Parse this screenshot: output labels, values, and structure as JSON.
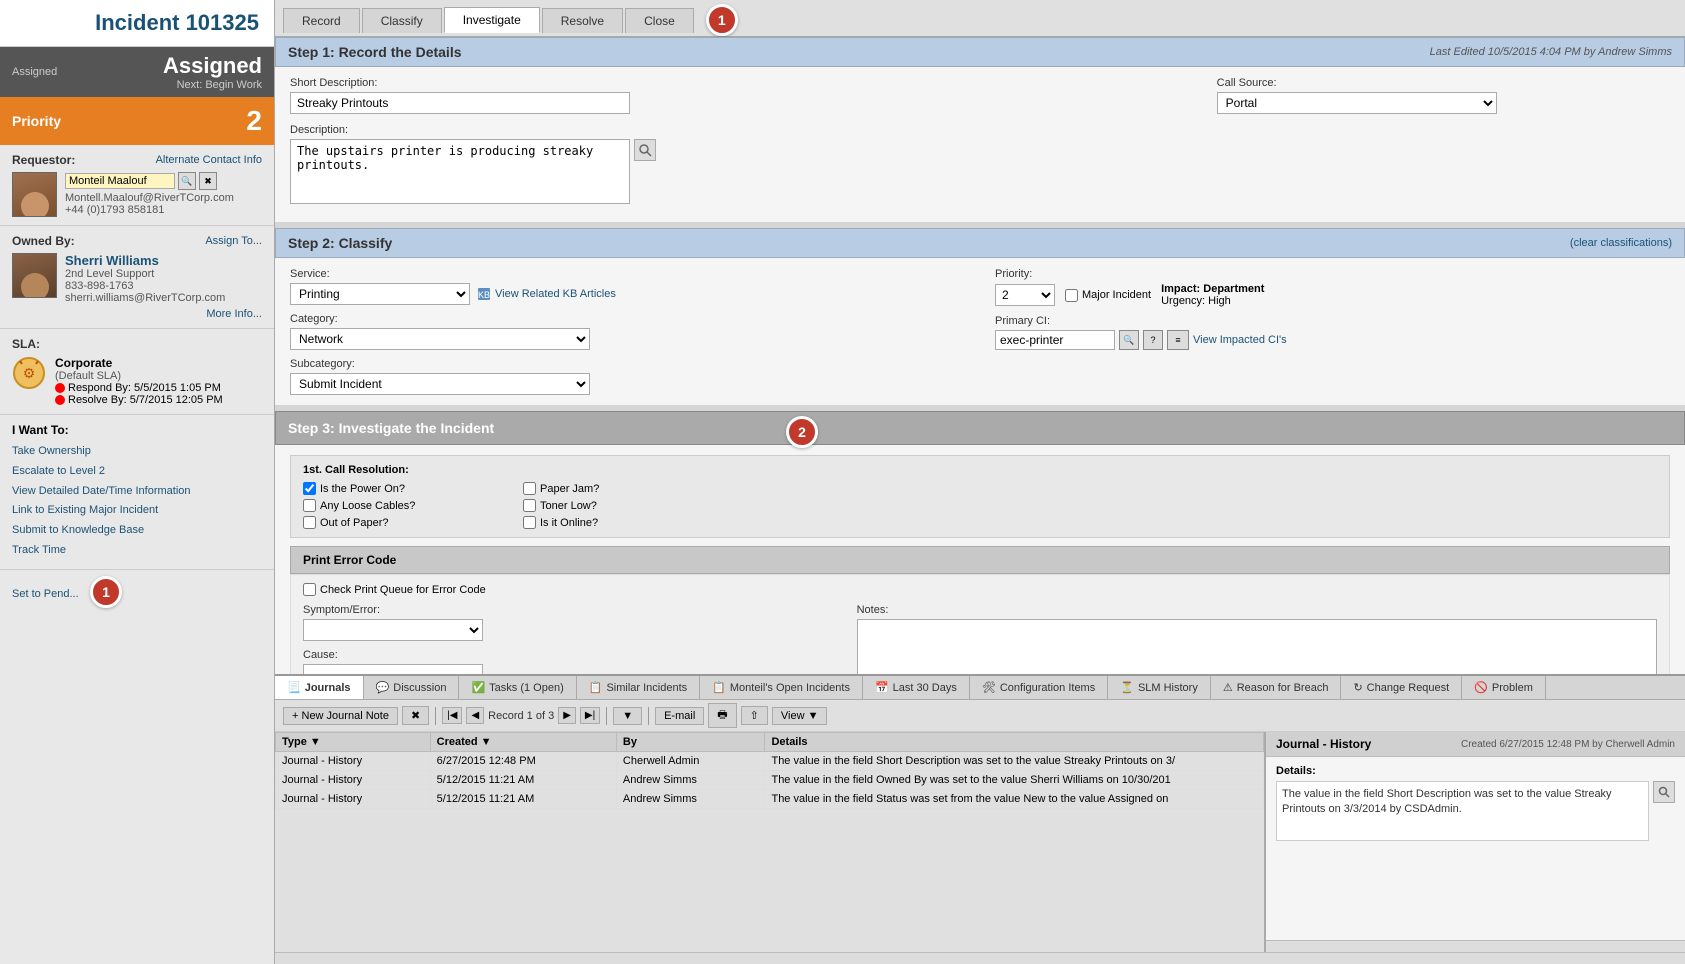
{
  "incident": {
    "title": "Incident 101325",
    "status": "Assigned",
    "status_next": "Next: Begin Work",
    "priority_label": "Priority",
    "priority_num": "2"
  },
  "tabs": {
    "items": [
      "Record",
      "Classify",
      "Investigate",
      "Resolve",
      "Close"
    ],
    "active": "Investigate",
    "badge": "1"
  },
  "requestor": {
    "label": "Requestor:",
    "alt_contact": "Alternate Contact Info",
    "name": "Monteil Maalouf",
    "email": "Montell.Maalouf@RiverTCorp.com",
    "phone": "+44 (0)1793 858181"
  },
  "owned_by": {
    "label": "Owned By:",
    "assign_link": "Assign To...",
    "name": "Sherri Williams",
    "level": "2nd Level Support",
    "phone": "833-898-1763",
    "email": "sherri.williams@RiverTCorp.com",
    "more_info": "More Info..."
  },
  "sla": {
    "label": "SLA:",
    "name": "Corporate",
    "default": "(Default SLA)",
    "respond_by": "Respond By: 5/5/2015 1:05 PM",
    "resolve_by": "Resolve By: 5/7/2015 12:05 PM"
  },
  "i_want_to": {
    "label": "I Want To:",
    "items": [
      "Take Ownership",
      "Escalate to Level 2",
      "View Detailed Date/Time Information",
      "Link to Existing Major Incident",
      "Submit to Knowledge Base",
      "Track Time"
    ]
  },
  "set_to_pending": "Set to Pend...",
  "step1": {
    "title": "Step 1:  Record the Details",
    "last_edited": "Last Edited 10/5/2015 4:04 PM by Andrew Simms",
    "short_desc_label": "Short Description:",
    "short_desc_value": "Streaky Printouts",
    "call_source_label": "Call Source:",
    "call_source_value": "Portal",
    "description_label": "Description:",
    "description_value": "The upstairs printer is producing streaky printouts."
  },
  "step2": {
    "title": "Step 2:  Classify",
    "clear_link": "(clear classifications)",
    "service_label": "Service:",
    "service_value": "Printing",
    "view_kb": "View Related KB Articles",
    "priority_label": "Priority:",
    "priority_value": "2",
    "major_incident_label": "Major Incident",
    "impact_label": "Impact: Department",
    "urgency_label": "Urgency: High",
    "category_label": "Category:",
    "category_value": "Network",
    "primary_ci_label": "Primary CI:",
    "primary_ci_value": "exec-printer",
    "view_impacted": "View Impacted CI's",
    "subcategory_label": "Subcategory:",
    "subcategory_value": "Submit Incident"
  },
  "step3": {
    "title": "Step 3:  Investigate the Incident",
    "badge": "2",
    "first_call_label": "1st. Call Resolution:",
    "checkboxes": [
      {
        "label": "Is the Power On?",
        "checked": true
      },
      {
        "label": "Paper Jam?",
        "checked": false
      },
      {
        "label": "Any Loose Cables?",
        "checked": false
      },
      {
        "label": "Toner Low?",
        "checked": false
      },
      {
        "label": "Out of Paper?",
        "checked": false
      },
      {
        "label": "Is it Online?",
        "checked": false
      }
    ],
    "print_error_title": "Print Error Code",
    "check_print_queue": "Check Print Queue for Error Code",
    "symptom_label": "Symptom/Error:",
    "cause_label": "Cause:",
    "notes_label": "Notes:"
  },
  "bottom_tabs": [
    "Journals",
    "Discussion",
    "Tasks (1 Open)",
    "Similar Incidents",
    "Monteil's Open Incidents",
    "Last 30 Days",
    "Configuration Items",
    "SLM History",
    "Reason for Breach",
    "Change Request",
    "Problem"
  ],
  "bottom_active_tab": "Journals",
  "journal_toolbar": {
    "new_note": "New Journal Note",
    "record_info": "Record 1 of 3",
    "email": "E-mail",
    "view": "View"
  },
  "journal_columns": [
    "Type",
    "Created",
    "By",
    "Details"
  ],
  "journal_rows": [
    {
      "type": "Journal - History",
      "created": "6/27/2015  12:48 PM",
      "by": "Cherwell Admin",
      "details": "The value in the field Short Description was set to the value Streaky Printouts on 3/"
    },
    {
      "type": "Journal - History",
      "created": "5/12/2015  11:21 AM",
      "by": "Andrew Simms",
      "details": "The value in the field Owned By was set to the value Sherri Williams on 10/30/201"
    },
    {
      "type": "Journal - History",
      "created": "5/12/2015  11:21 AM",
      "by": "Andrew Simms",
      "details": "The value in the field Status was set from the value New to the value Assigned on"
    }
  ],
  "journal_detail": {
    "title": "Journal - History",
    "created_info": "Created 6/27/2015 12:48 PM by Cherwell Admin",
    "details_label": "Details:",
    "details_text": "The value in the field Short Description was set to the value Streaky Printouts on 3/3/2014 by CSDAdmin."
  }
}
